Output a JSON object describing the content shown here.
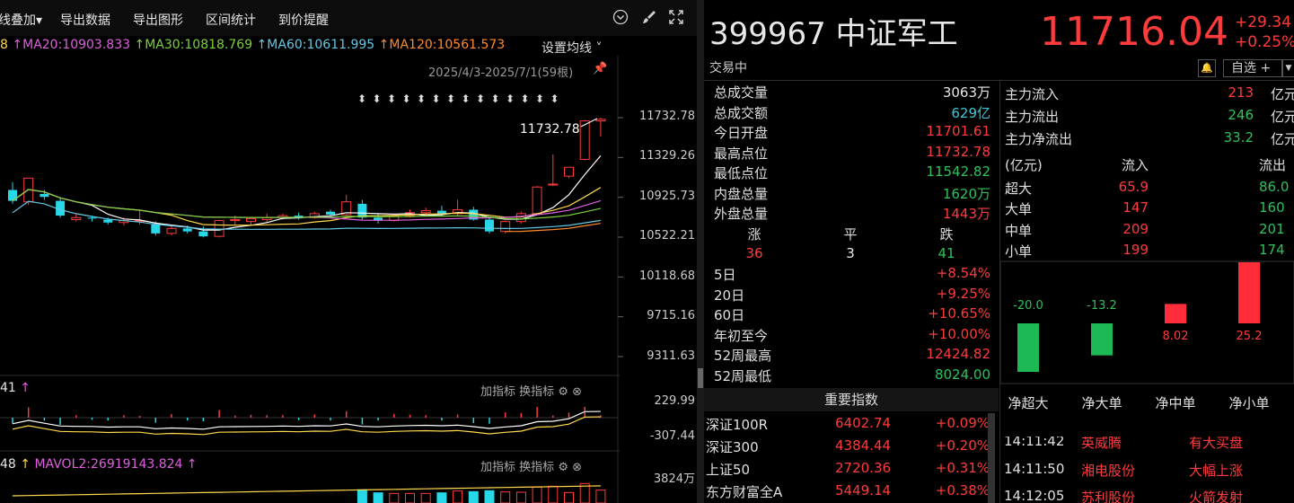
{
  "toolbar": {
    "items": [
      "线叠加",
      "导出数据",
      "导出图形",
      "区间统计",
      "到价提醒"
    ],
    "overlay_suffix": "▾"
  },
  "ma": {
    "ma10_tail": "8",
    "ma20": "MA20:10903.833",
    "ma30": "MA30:10818.769",
    "ma60": "MA60:10611.995",
    "ma120": "MA120:10561.573",
    "setting": "设置均线",
    "colors": {
      "ma10": "#ffd84d",
      "ma20": "#e060e0",
      "ma30": "#7bd23c",
      "ma60": "#62c9e6",
      "ma120": "#ff8c2a"
    }
  },
  "chart": {
    "range": "2025/4/3-2025/7/1(59根)",
    "high_label": "11732.78",
    "price_axis": [
      "11732.78",
      "11329.26",
      "10925.73",
      "10522.21",
      "10118.68",
      "9715.16",
      "9311.63"
    ],
    "macd_axis": [
      "229.99",
      "-307.44"
    ],
    "vol_axis": [
      "3824万"
    ],
    "ind1_label_val": "41",
    "ind2_label_val": "48",
    "mavol2": "MAVOL2:26919143.824",
    "add_indicator": "加指标",
    "swap_indicator": "换指标"
  },
  "chart_data": {
    "type": "candlestick",
    "title": "",
    "xlabel": "",
    "ylabel": "",
    "ylim": [
      9311.63,
      11732.78
    ],
    "candles": [
      {
        "o": 11000,
        "h": 11080,
        "l": 10860,
        "c": 10890
      },
      {
        "o": 10880,
        "h": 11120,
        "l": 10850,
        "c": 11120
      },
      {
        "o": 10960,
        "h": 11000,
        "l": 10900,
        "c": 10930
      },
      {
        "o": 10890,
        "h": 10920,
        "l": 10720,
        "c": 10740
      },
      {
        "o": 10700,
        "h": 10760,
        "l": 10680,
        "c": 10720
      },
      {
        "o": 10720,
        "h": 10740,
        "l": 10680,
        "c": 10710
      },
      {
        "o": 10700,
        "h": 10720,
        "l": 10650,
        "c": 10670
      },
      {
        "o": 10670,
        "h": 10720,
        "l": 10640,
        "c": 10690
      },
      {
        "o": 10690,
        "h": 10800,
        "l": 10650,
        "c": 10690
      },
      {
        "o": 10650,
        "h": 10680,
        "l": 10540,
        "c": 10560
      },
      {
        "o": 10560,
        "h": 10640,
        "l": 10540,
        "c": 10610
      },
      {
        "o": 10610,
        "h": 10640,
        "l": 10560,
        "c": 10580
      },
      {
        "o": 10580,
        "h": 10630,
        "l": 10520,
        "c": 10530
      },
      {
        "o": 10530,
        "h": 10700,
        "l": 10520,
        "c": 10690
      },
      {
        "o": 10690,
        "h": 10740,
        "l": 10640,
        "c": 10700
      },
      {
        "o": 10680,
        "h": 10720,
        "l": 10650,
        "c": 10710
      },
      {
        "o": 10700,
        "h": 10760,
        "l": 10670,
        "c": 10720
      },
      {
        "o": 10720,
        "h": 10760,
        "l": 10700,
        "c": 10740
      },
      {
        "o": 10740,
        "h": 10770,
        "l": 10700,
        "c": 10720
      },
      {
        "o": 10720,
        "h": 10780,
        "l": 10710,
        "c": 10760
      },
      {
        "o": 10780,
        "h": 10800,
        "l": 10730,
        "c": 10750
      },
      {
        "o": 10750,
        "h": 10950,
        "l": 10740,
        "c": 10880
      },
      {
        "o": 10860,
        "h": 10900,
        "l": 10700,
        "c": 10720
      },
      {
        "o": 10720,
        "h": 10760,
        "l": 10660,
        "c": 10690
      },
      {
        "o": 10690,
        "h": 10760,
        "l": 10680,
        "c": 10740
      },
      {
        "o": 10740,
        "h": 10800,
        "l": 10720,
        "c": 10770
      },
      {
        "o": 10770,
        "h": 10820,
        "l": 10740,
        "c": 10790
      },
      {
        "o": 10790,
        "h": 10840,
        "l": 10740,
        "c": 10760
      },
      {
        "o": 10760,
        "h": 10900,
        "l": 10740,
        "c": 10800
      },
      {
        "o": 10800,
        "h": 10830,
        "l": 10690,
        "c": 10700
      },
      {
        "o": 10700,
        "h": 10730,
        "l": 10560,
        "c": 10580
      },
      {
        "o": 10580,
        "h": 10690,
        "l": 10560,
        "c": 10680
      },
      {
        "o": 10680,
        "h": 10780,
        "l": 10660,
        "c": 10760
      },
      {
        "o": 10760,
        "h": 11040,
        "l": 10750,
        "c": 11030
      },
      {
        "o": 11050,
        "h": 11360,
        "l": 11040,
        "c": 11060
      },
      {
        "o": 11140,
        "h": 11230,
        "l": 11120,
        "c": 11230
      },
      {
        "o": 11310,
        "h": 11710,
        "l": 11300,
        "c": 11700
      },
      {
        "o": 11700,
        "h": 11732.78,
        "l": 11542.82,
        "c": 11716.04
      }
    ]
  },
  "quote": {
    "code_name": "399967 中证军工",
    "price": "11716.04",
    "chg": "+29.34",
    "pct": "+0.25%",
    "status": "交易中",
    "watch": "自选 +"
  },
  "stats": [
    {
      "label": "总成交量",
      "value": "3063万",
      "color": "white"
    },
    {
      "label": "总成交额",
      "value": "629亿",
      "color": "cyan"
    },
    {
      "label": "今日开盘",
      "value": "11701.61",
      "color": "red"
    },
    {
      "label": "最高点位",
      "value": "11732.78",
      "color": "red"
    },
    {
      "label": "最低点位",
      "value": "11542.82",
      "color": "green"
    },
    {
      "label": "内盘总量",
      "value": "1620万",
      "color": "green"
    },
    {
      "label": "外盘总量",
      "value": "1443万",
      "color": "red"
    }
  ],
  "breadth": {
    "head": [
      "涨",
      "平",
      "跌"
    ],
    "vals": [
      "36",
      "3",
      "41"
    ]
  },
  "returns": [
    {
      "label": "5日",
      "value": "+8.54%",
      "color": "red"
    },
    {
      "label": "20日",
      "value": "+9.25%",
      "color": "red"
    },
    {
      "label": "60日",
      "value": "+10.65%",
      "color": "red"
    },
    {
      "label": "年初至今",
      "value": "+10.00%",
      "color": "red"
    },
    {
      "label": "52周最高",
      "value": "12424.82",
      "color": "red"
    },
    {
      "label": "52周最低",
      "value": "8024.00",
      "color": "green"
    }
  ],
  "flow": {
    "main": [
      {
        "label": "主力流入",
        "value": "213",
        "unit": "亿元",
        "color": "red"
      },
      {
        "label": "主力流出",
        "value": "246",
        "unit": "亿元",
        "color": "green"
      },
      {
        "label": "主力净流出",
        "value": "33.2",
        "unit": "亿元",
        "color": "green"
      }
    ],
    "table_head": {
      "unit": "(亿元)",
      "in": "流入",
      "out": "流出"
    },
    "rows": [
      {
        "label": "超大",
        "in": "65.9",
        "out": "86.0"
      },
      {
        "label": "大单",
        "in": "147",
        "out": "160"
      },
      {
        "label": "中单",
        "in": "209",
        "out": "201"
      },
      {
        "label": "小单",
        "in": "199",
        "out": "174"
      }
    ],
    "net": [
      {
        "label": "净超大",
        "value": "-20.0",
        "num": -20.0
      },
      {
        "label": "净大单",
        "value": "-13.2",
        "num": -13.2
      },
      {
        "label": "净中单",
        "value": "8.02",
        "num": 8.02
      },
      {
        "label": "净小单",
        "value": "25.2",
        "num": 25.2
      }
    ]
  },
  "indices": {
    "title": "重要指数",
    "rows": [
      {
        "name": "深证100R",
        "price": "6402.74",
        "chg": "+0.09%"
      },
      {
        "name": "深证300",
        "price": "4384.44",
        "chg": "+0.20%"
      },
      {
        "name": "上证50",
        "price": "2720.36",
        "chg": "+0.31%"
      },
      {
        "name": "东方财富全A",
        "price": "5449.14",
        "chg": "+0.38%"
      }
    ]
  },
  "ticker": [
    {
      "time": "14:11:42",
      "stock": "英威腾",
      "event": "有大买盘"
    },
    {
      "time": "14:11:50",
      "stock": "湘电股份",
      "event": "大幅上涨"
    },
    {
      "time": "14:12:05",
      "stock": "苏利股份",
      "event": "火箭发射"
    }
  ]
}
